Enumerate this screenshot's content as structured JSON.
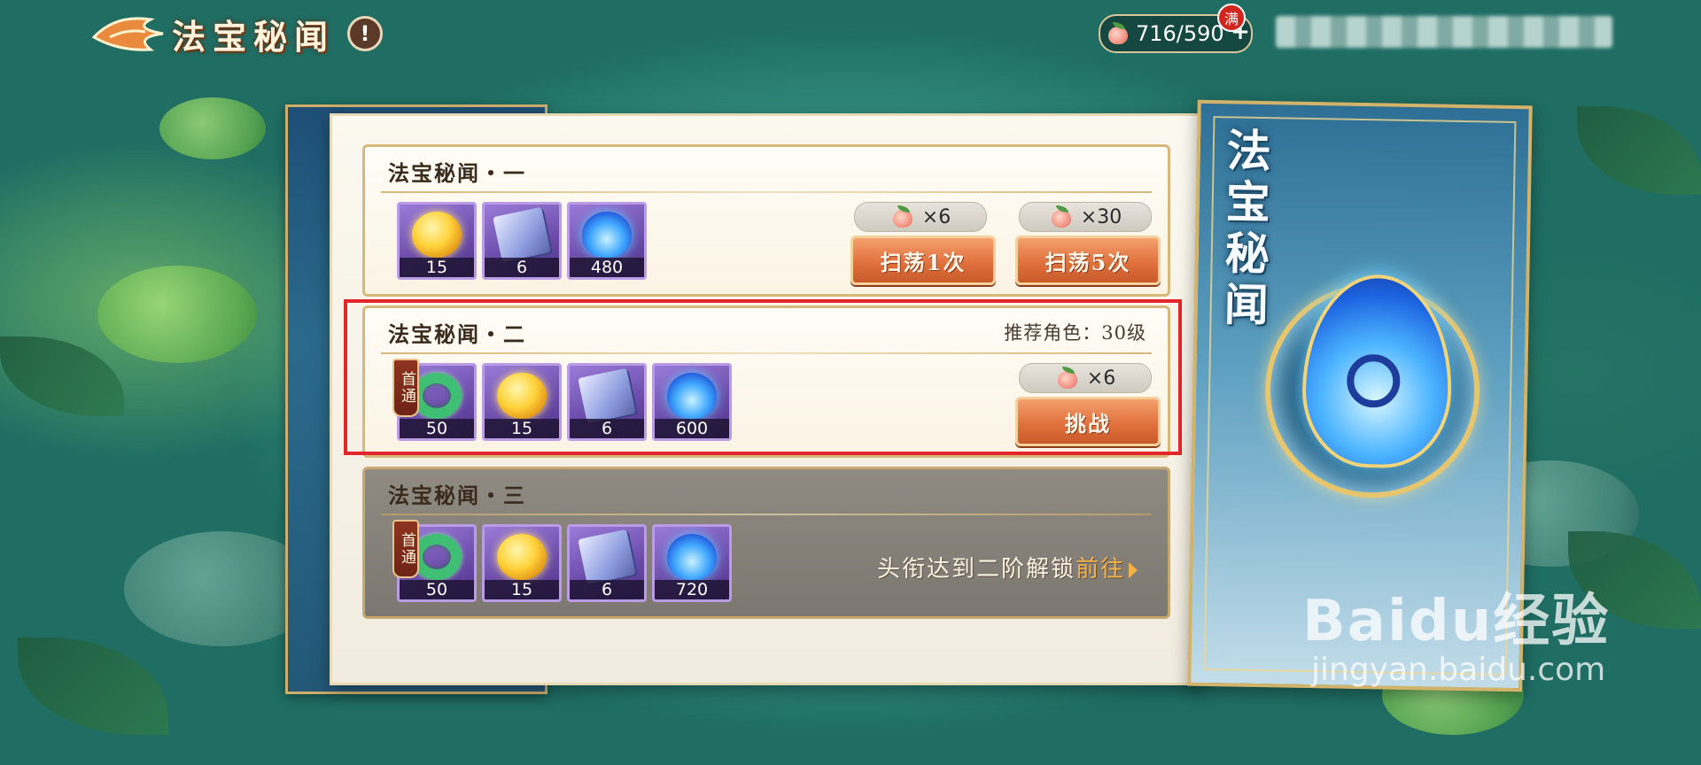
{
  "header": {
    "title": "法宝秘闻",
    "info_icon": "!",
    "stamina": {
      "value": "716/590",
      "icon": "peach-icon",
      "full_badge": "满",
      "add_label": "+"
    }
  },
  "levels": [
    {
      "title": "法宝秘闻・一",
      "rewards": [
        {
          "icon": "gold-orb-icon",
          "qty": "15"
        },
        {
          "icon": "exp-book-icon",
          "qty": "6"
        },
        {
          "icon": "blue-flame-icon",
          "qty": "480"
        }
      ],
      "actions": [
        {
          "cost": "×6",
          "label": "扫荡1次"
        },
        {
          "cost": "×30",
          "label": "扫荡5次"
        }
      ]
    },
    {
      "title": "法宝秘闻・二",
      "recommend": "推荐角色：30级",
      "first_clear_badge": "首通",
      "rewards": [
        {
          "icon": "jade-dragon-ring-icon",
          "qty": "50"
        },
        {
          "icon": "gold-orb-icon",
          "qty": "15"
        },
        {
          "icon": "exp-book-icon",
          "qty": "6"
        },
        {
          "icon": "blue-flame-icon",
          "qty": "600"
        }
      ],
      "action": {
        "cost": "×6",
        "label": "挑战"
      },
      "highlighted": true
    },
    {
      "title": "法宝秘闻・三",
      "first_clear_badge": "首通",
      "rewards": [
        {
          "icon": "jade-dragon-ring-icon",
          "qty": "50"
        },
        {
          "icon": "gold-orb-icon",
          "qty": "15"
        },
        {
          "icon": "exp-book-icon",
          "qty": "6"
        },
        {
          "icon": "blue-flame-icon",
          "qty": "720"
        }
      ],
      "unlock_text": "头衔达到二阶解锁",
      "goto_label": "前往",
      "locked": true
    }
  ],
  "side_card": {
    "title": "法宝秘闻",
    "art": "blue-flame-treasure-icon"
  },
  "watermark": {
    "brand": "Baidu经验",
    "url": "jingyan.baidu.com"
  },
  "colors": {
    "highlight": "#e3262b",
    "button": "#e0723e",
    "goto_link": "#f4b34a"
  }
}
